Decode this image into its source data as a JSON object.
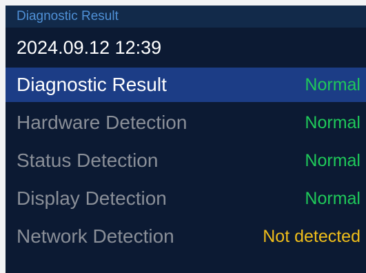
{
  "header": {
    "title": "Diagnostic Result"
  },
  "datetime": "2024.09.12 12:39",
  "colors": {
    "normal": "#1fc95a",
    "not_detected": "#f0be1a",
    "selected_row": "#1c3d86",
    "background": "#0c1a33"
  },
  "rows": [
    {
      "label": "Diagnostic Result",
      "value": "Normal",
      "status": "normal",
      "selected": true
    },
    {
      "label": "Hardware Detection",
      "value": "Normal",
      "status": "normal",
      "selected": false
    },
    {
      "label": "Status Detection",
      "value": "Normal",
      "status": "normal",
      "selected": false
    },
    {
      "label": "Display Detection",
      "value": "Normal",
      "status": "normal",
      "selected": false
    },
    {
      "label": "Network Detection",
      "value": "Not detected",
      "status": "not_detected",
      "selected": false
    }
  ]
}
